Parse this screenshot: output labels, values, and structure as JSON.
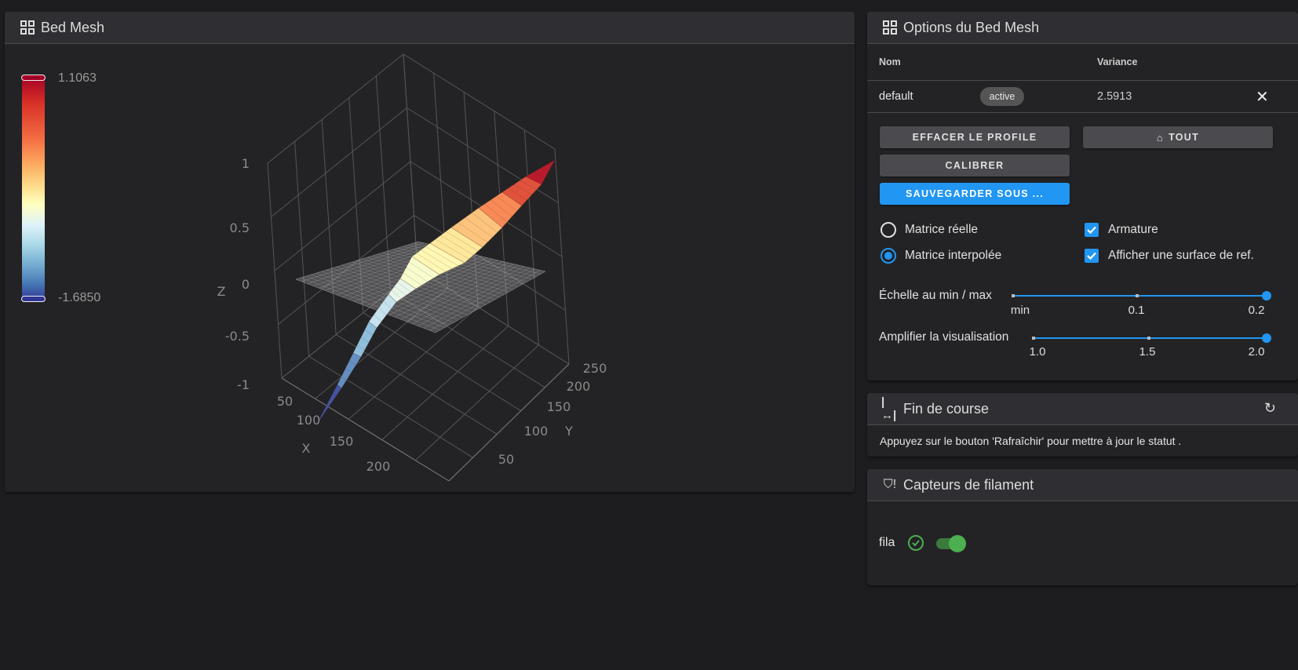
{
  "bed_mesh_panel": {
    "title": "Bed Mesh",
    "icon": "grid-icon",
    "colorbar": {
      "max_label": "1.1063",
      "min_label": "-1.6850",
      "colors": [
        "#a50026",
        "#f46d43",
        "#fee090",
        "#ffffbf",
        "#e0f3f8",
        "#74add1",
        "#313695"
      ]
    }
  },
  "chart_data": {
    "type": "surface3d",
    "x_axis": {
      "label": "X",
      "ticks": [
        "50",
        "100",
        "150",
        "200"
      ]
    },
    "y_axis": {
      "label": "Y",
      "ticks": [
        "50",
        "100",
        "150",
        "200",
        "250"
      ]
    },
    "z_axis": {
      "label": "Z",
      "ticks": [
        "1",
        "0.5",
        "0",
        "-0.5",
        "-1"
      ],
      "range": [
        -1,
        1
      ]
    },
    "z_min": -1.685,
    "z_max": 1.1063,
    "reference_plane_z": 0,
    "wireframe": true
  },
  "options_panel": {
    "title": "Options du Bed Mesh",
    "icon": "grid-icon",
    "table": {
      "headers": {
        "name": "Nom",
        "variance": "Variance"
      },
      "rows": [
        {
          "name": "default",
          "badge": "active",
          "variance": "2.5913"
        }
      ]
    },
    "buttons": {
      "clear": "EFFACER LE PROFILE",
      "home": "TOUT",
      "calibrate": "CALIBRER",
      "save_as": "SAUVEGARDER SOUS ..."
    },
    "radios": [
      {
        "label": "Matrice réelle",
        "checked": false
      },
      {
        "label": "Matrice interpolée",
        "checked": true
      }
    ],
    "checkboxes": [
      {
        "label": "Armature",
        "checked": true
      },
      {
        "label": "Afficher une surface de ref.",
        "checked": true
      }
    ],
    "scale_slider": {
      "label": "Échelle au min / max",
      "ticks": [
        "min",
        "0.1",
        "0.2"
      ],
      "value": "0.2"
    },
    "amplify_slider": {
      "label": "Amplifier la visualisation",
      "ticks": [
        "1.0",
        "1.5",
        "2.0"
      ],
      "value": "2.0"
    },
    "accent": "#2196f3"
  },
  "endstops_panel": {
    "title": "Fin de course",
    "message": "Appuyez sur le bouton 'Rafraîchir' pour mettre à jour le statut ."
  },
  "filament_panel": {
    "title": "Capteurs de filament",
    "sensors": [
      {
        "name": "fila",
        "status": "ok",
        "enabled": true
      }
    ],
    "status_color": "#4caf50"
  }
}
